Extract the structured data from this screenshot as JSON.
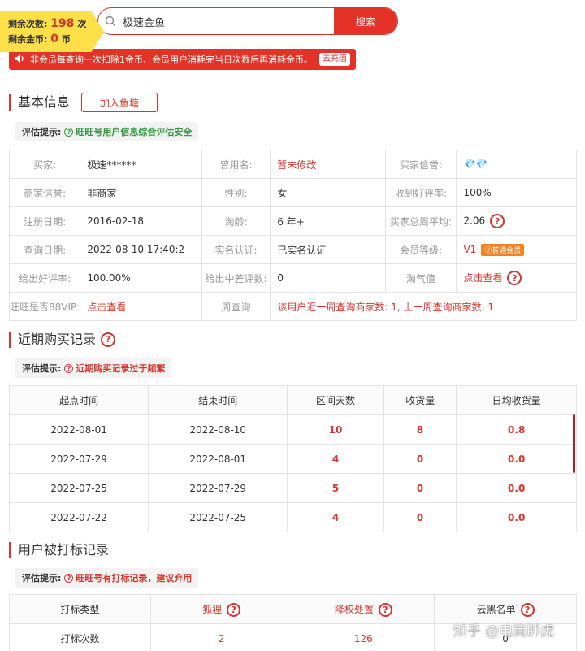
{
  "quota": {
    "remaining_label": "剩余次数:",
    "remaining_value": "198",
    "remaining_unit": "次",
    "coins_label": "剩余金币:",
    "coins_value": "0",
    "coins_unit": "币"
  },
  "search": {
    "value": "极速金鱼",
    "button": "搜索"
  },
  "notice": {
    "text": "非会员每查询一次扣除1金币、会员用户消耗完当日次数后再消耗金币。",
    "charge": "去充值"
  },
  "basic": {
    "title": "基本信息",
    "add_button": "加入鱼塘",
    "tip_label": "评估提示:",
    "tip_text": "旺旺号用户信息综合评估安全",
    "rows": [
      {
        "k1": "买家:",
        "v1": "极速******",
        "k2": "曾用名:",
        "v2": "暂未修改",
        "k3": "买家信誉:",
        "v3": "💎💎"
      },
      {
        "k1": "商家信誉:",
        "v1": "非商家",
        "k2": "性别:",
        "v2": "女",
        "k3": "收到好评率:",
        "v3": "100%"
      },
      {
        "k1": "注册日期:",
        "v1": "2016-02-18",
        "k2": "淘龄:",
        "v2": "6 年+",
        "k3": "买家总周平均:",
        "v3": "2.06"
      },
      {
        "k1": "查询日期:",
        "v1": "2022-08-10 17:40:2",
        "k2": "实名认证:",
        "v2": "已实名认证",
        "k3": "会员等级:",
        "v3": "V1",
        "v3_tag": "普通会员"
      },
      {
        "k1": "给出好评率:",
        "v1": "100.00%",
        "k2": "给出中差评数:",
        "v2": "0",
        "k3": "淘气值",
        "v3": "点击查看"
      },
      {
        "k1": "旺旺是否88VIP:",
        "v1": "点击查看",
        "k2": "周查询",
        "v2": "该用户近一周查询商家数:  1,  上一周查询商家数:  1"
      }
    ]
  },
  "purchase": {
    "title": "近期购买记录",
    "tip_label": "评估提示:",
    "tip_text": "近期购买记录过于频繁",
    "headers": [
      "起点时间",
      "结束时间",
      "区间天数",
      "收货量",
      "日均收货量"
    ],
    "rows": [
      [
        "2022-08-01",
        "2022-08-10",
        "10",
        "8",
        "0.8"
      ],
      [
        "2022-07-29",
        "2022-08-01",
        "4",
        "0",
        "0.0"
      ],
      [
        "2022-07-25",
        "2022-07-29",
        "5",
        "0",
        "0.0"
      ],
      [
        "2022-07-22",
        "2022-07-25",
        "4",
        "0",
        "0.0"
      ]
    ]
  },
  "marks": {
    "title": "用户被打标记录",
    "tip_label": "评估提示:",
    "tip_text": "旺旺号有打标记录，建议弃用",
    "headers": [
      "打标类型",
      "狐狸",
      "降权处置",
      "云黑名单"
    ],
    "row": [
      "打标次数",
      "2",
      "126",
      "0"
    ]
  },
  "watermark": "知乎 @电商胖虎",
  "colors": {
    "accent": "#e53228",
    "badge": "#fde047",
    "safe": "#2f9a3b"
  }
}
